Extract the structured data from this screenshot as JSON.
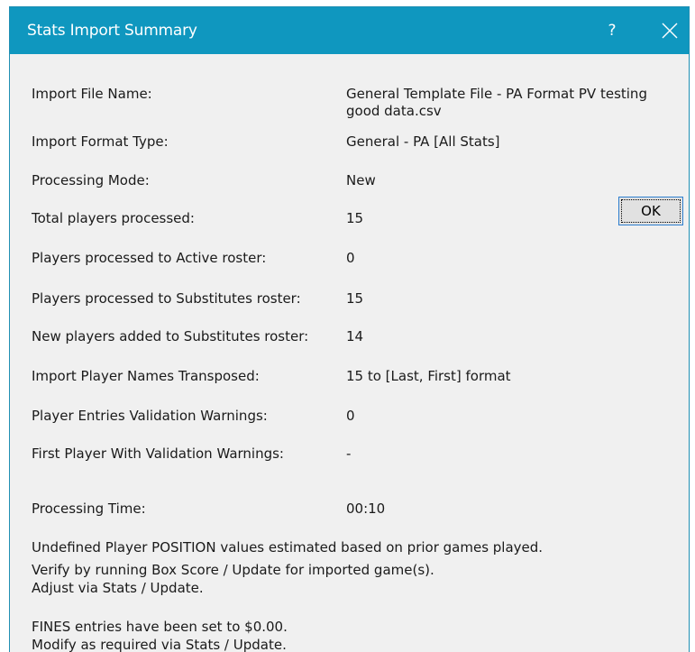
{
  "window": {
    "title": "Stats Import Summary",
    "help_label": "?",
    "accent_color": "#0f97bf"
  },
  "rows": [
    {
      "label": "Import File Name:",
      "value": "General Template File - PA Format PV testing good data.csv"
    },
    {
      "label": "Import Format Type:",
      "value": "General - PA [All Stats]"
    },
    {
      "label": "Processing Mode:",
      "value": "New"
    },
    {
      "label": "Total players processed:",
      "value": "15"
    },
    {
      "label": "Players processed to Active roster:",
      "value": "0"
    },
    {
      "label": "Players processed to Substitutes roster:",
      "value": "15"
    },
    {
      "label": "New players added to Substitutes roster:",
      "value": "14"
    },
    {
      "label": "Import Player Names Transposed:",
      "value": "15 to [Last, First] format"
    },
    {
      "label": "Player Entries Validation Warnings:",
      "value": "0"
    },
    {
      "label": "First Player With Validation Warnings:",
      "value": "-"
    },
    {
      "label": "Processing Time:",
      "value": "00:10"
    }
  ],
  "ok_button": {
    "label": "OK"
  },
  "notes": [
    "Undefined Player POSITION values estimated based on prior games played.",
    "Verify by running Box Score / Update for imported game(s).",
    "Adjust via Stats / Update.",
    "FINES entries have been set to $0.00.",
    "Modify as required via Stats / Update."
  ],
  "icons": {
    "help": "help-icon",
    "close": "close-icon"
  }
}
